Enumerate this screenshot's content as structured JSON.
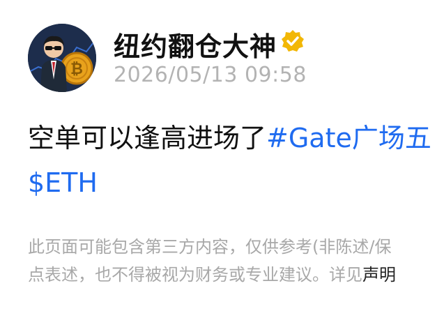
{
  "author": {
    "name": "纽约翻仓大神",
    "timestamp": "2026/05/13 09:58",
    "avatar_icon": "trader-with-bitcoin-avatar",
    "verified_icon": "verified-badge-icon"
  },
  "post": {
    "text": "空单可以逢高进场了",
    "hashtag": "#Gate广场五",
    "ticker": "$ETH"
  },
  "disclaimer": {
    "line1": "此页面可能包含第三方内容，仅供参考(非陈述/保",
    "line2_text": "点表述，也不得被视为财务或专业建议。详见",
    "link": "声明"
  },
  "colors": {
    "link_blue": "#1f6bf0",
    "text_dark": "#111111",
    "muted_gray": "#a8a8a8",
    "badge_gold": "#f2b705"
  }
}
